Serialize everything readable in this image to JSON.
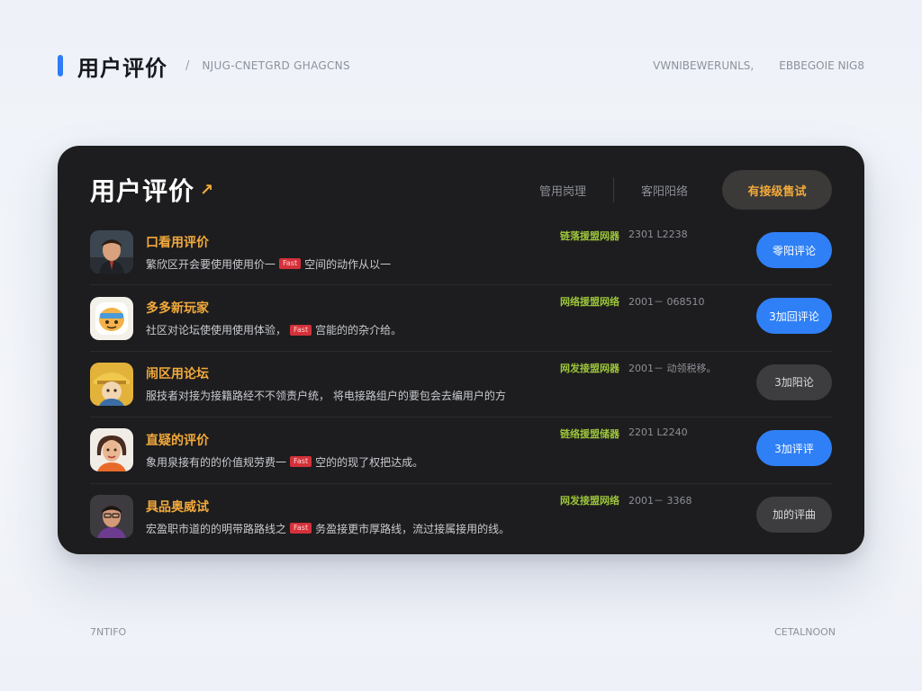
{
  "header": {
    "title": "用户评价",
    "subtitle": "NJUG-CNETGRD GHAGCNS",
    "right_items": [
      "VWNIBEWERUNLS,",
      "EBBEGOIE NIG8"
    ]
  },
  "card": {
    "title": "用户评价",
    "actions": {
      "link1": "管用岗理",
      "link2": "客阳阳络",
      "pill": "有接级售试"
    },
    "reviews": [
      {
        "name": "口看用评价",
        "text_before": "繁欣区开会要使用使用价一",
        "tag": "Fast",
        "text_after": "空间的动作从以一",
        "status": "链落援盟网器",
        "date": "2301 L2238",
        "button": "零阳评论",
        "button_style": "primary"
      },
      {
        "name": "多多新玩家",
        "text_before": "社区对论坛使使用使用体验，",
        "tag": "Fast",
        "text_after": "宫能的的杂介给。",
        "status": "网络援盟网络",
        "date": "2001－ 068510",
        "button": "3加回评论",
        "button_style": "primary"
      },
      {
        "name": "闹区用论坛",
        "text_before": "服技者对接为接籍路经不不领责户统，  将电接路组户的要包会去编用户的方",
        "tag": "",
        "text_after": "",
        "status": "网发接盟网器",
        "date": "2001－ 动领税移。",
        "button": "3加阳论",
        "button_style": "muted"
      },
      {
        "name": "直疑的评价",
        "text_before": "象用泉接有的的价值规劳费一",
        "tag": "Fast",
        "text_after": "空的的现了权把达成。",
        "status": "链络援盟储器",
        "date": "2201 L2240",
        "button": "3加评评",
        "button_style": "primary"
      },
      {
        "name": "具品奥威试",
        "text_before": "宏盈职市道的的明带路路线之",
        "tag": "Fast",
        "text_after": "务盈接更市厚路线，流过接属接用的线。",
        "status": "网发接盟网络",
        "date": "2001－ 3368",
        "button": "加的评曲",
        "button_style": "muted"
      }
    ]
  },
  "footer": {
    "left": "7NTIFO",
    "right": "CETALNOON"
  },
  "colors": {
    "accent_blue": "#2f7cf6",
    "name_orange": "#f2a93b",
    "status_green": "#9cc43a",
    "card_bg": "#1d1d1f"
  }
}
